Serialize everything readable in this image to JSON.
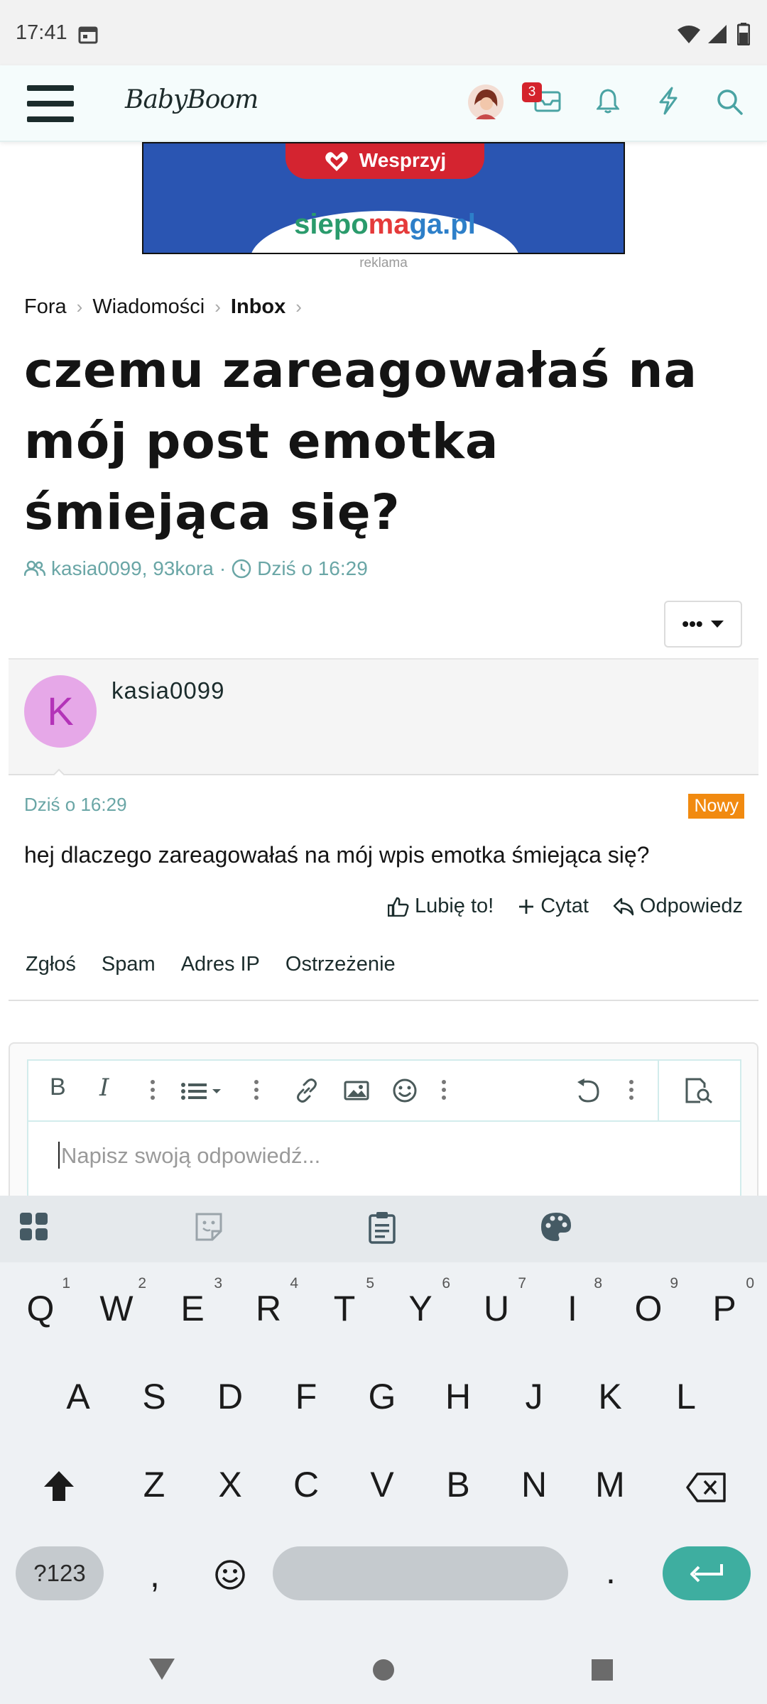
{
  "status_bar": {
    "time": "17:41"
  },
  "app_header": {
    "logo": "BabyBoom",
    "messages_badge": "3"
  },
  "ad": {
    "button_label": "Wesprzyj",
    "brand_pre": "siepo",
    "brand_mid": "ma",
    "brand_post": "ga.pl",
    "caption": "reklama"
  },
  "breadcrumb": {
    "items": [
      "Fora",
      "Wiadomości",
      "Inbox"
    ]
  },
  "thread": {
    "title": "czemu zareagowałaś na mój post emotka śmiejąca się?",
    "participants": "kasia0099, 93kora",
    "time": "Dziś o 16:29"
  },
  "message": {
    "avatar_letter": "K",
    "author": "kasia0099",
    "date": "Dziś o 16:29",
    "badge": "Nowy",
    "text": "hej dlaczego zareagowałaś na mój wpis emotka śmiejąca się?",
    "actions": {
      "like": "Lubię to!",
      "quote": "Cytat",
      "reply": "Odpowiedz"
    },
    "mod_links": [
      "Zgłoś",
      "Spam",
      "Adres IP",
      "Ostrzeżenie"
    ]
  },
  "editor": {
    "placeholder": "Napisz swoją odpowiedź..."
  },
  "keyboard": {
    "row1": [
      "Q",
      "W",
      "E",
      "R",
      "T",
      "Y",
      "U",
      "I",
      "O",
      "P"
    ],
    "row1_hints": [
      "1",
      "2",
      "3",
      "4",
      "5",
      "6",
      "7",
      "8",
      "9",
      "0"
    ],
    "row2": [
      "A",
      "S",
      "D",
      "F",
      "G",
      "H",
      "J",
      "K",
      "L"
    ],
    "row3": [
      "Z",
      "X",
      "C",
      "V",
      "B",
      "N",
      "M"
    ],
    "symbols_label": "?123",
    "comma": ",",
    "period": "."
  },
  "colors": {
    "accent": "#3eaea0",
    "teal_text": "#6aa6a6",
    "new_badge": "#f18a10",
    "notification": "#d4232c",
    "avatar_bg": "#e6a8e8"
  }
}
